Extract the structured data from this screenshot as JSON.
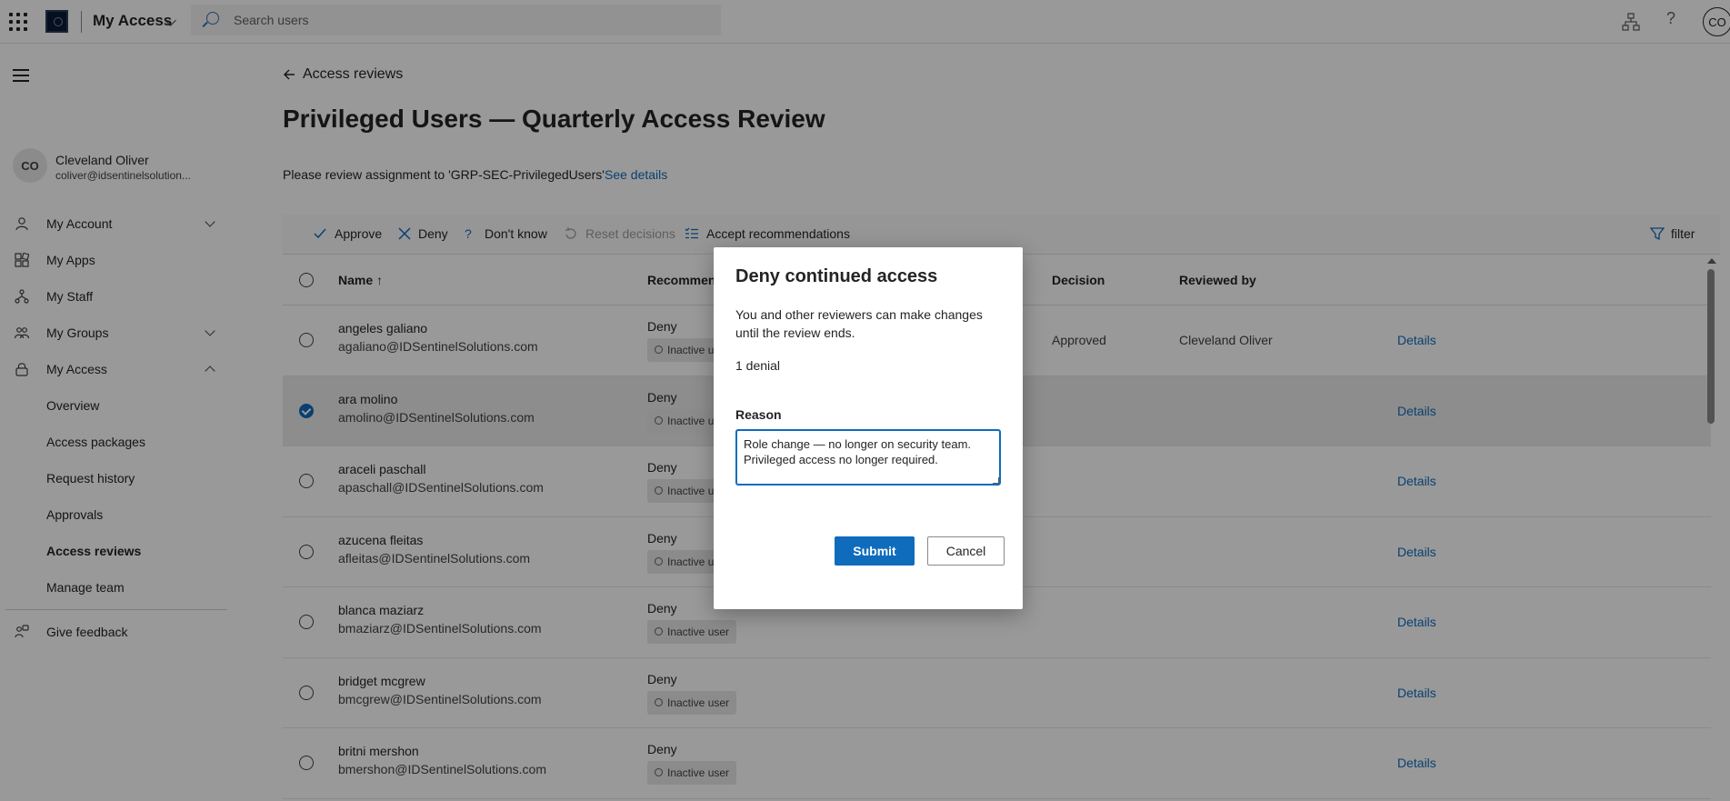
{
  "topbar": {
    "app_title": "My Access",
    "search_placeholder": "Search users",
    "avatar_initials": "CO"
  },
  "user": {
    "initials": "CO",
    "name": "Cleveland Oliver",
    "email": "coliver@idsentinelsolution..."
  },
  "sidebar": {
    "items": [
      {
        "label": "My Account",
        "icon": "person-icon",
        "expandable": true
      },
      {
        "label": "My Apps",
        "icon": "apps-icon",
        "expandable": false
      },
      {
        "label": "My Staff",
        "icon": "staff-icon",
        "expandable": false
      },
      {
        "label": "My Groups",
        "icon": "groups-icon",
        "expandable": true
      },
      {
        "label": "My Access",
        "icon": "lock-icon",
        "expandable": true,
        "expanded": true
      }
    ],
    "sub_items": [
      "Overview",
      "Access packages",
      "Request history",
      "Approvals",
      "Access reviews",
      "Manage team"
    ],
    "active_sub": "Access reviews",
    "feedback": "Give feedback"
  },
  "main": {
    "back_label": "Access reviews",
    "title": "Privileged Users — Quarterly Access Review",
    "instruction": "Please review assignment to 'GRP-SEC-PrivilegedUsers'",
    "see_details": "See details"
  },
  "toolbar": {
    "approve": "Approve",
    "deny": "Deny",
    "dont_know": "Don't know",
    "reset": "Reset decisions",
    "accept": "Accept recommendations",
    "filter": "filter"
  },
  "table": {
    "headers": {
      "name": "Name",
      "recommendation": "Recommen",
      "decision": "Decision",
      "reviewed_by": "Reviewed by"
    },
    "rows": [
      {
        "name": "angeles galiano",
        "email": "agaliano@IDSentinelSolutions.com",
        "rec": "Deny",
        "badge": "Inactive u",
        "decision": "Approved",
        "reviewed_by": "Cleveland Oliver",
        "details": "Details",
        "selected": false
      },
      {
        "name": "ara molino",
        "email": "amolino@IDSentinelSolutions.com",
        "rec": "Deny",
        "badge": "Inactive u",
        "decision": "",
        "reviewed_by": "",
        "details": "Details",
        "selected": true
      },
      {
        "name": "araceli paschall",
        "email": "apaschall@IDSentinelSolutions.com",
        "rec": "Deny",
        "badge": "Inactive u",
        "decision": "",
        "reviewed_by": "",
        "details": "Details",
        "selected": false
      },
      {
        "name": "azucena fleitas",
        "email": "afleitas@IDSentinelSolutions.com",
        "rec": "Deny",
        "badge": "Inactive u",
        "decision": "",
        "reviewed_by": "",
        "details": "Details",
        "selected": false
      },
      {
        "name": "blanca maziarz",
        "email": "bmaziarz@IDSentinelSolutions.com",
        "rec": "Deny",
        "badge": "Inactive user",
        "decision": "",
        "reviewed_by": "",
        "details": "Details",
        "selected": false
      },
      {
        "name": "bridget mcgrew",
        "email": "bmcgrew@IDSentinelSolutions.com",
        "rec": "Deny",
        "badge": "Inactive user",
        "decision": "",
        "reviewed_by": "",
        "details": "Details",
        "selected": false
      },
      {
        "name": "britni mershon",
        "email": "bmershon@IDSentinelSolutions.com",
        "rec": "Deny",
        "badge": "Inactive user",
        "decision": "",
        "reviewed_by": "",
        "details": "Details",
        "selected": false
      }
    ]
  },
  "dialog": {
    "title": "Deny continued access",
    "description": "You and other reviewers can make changes until the review ends.",
    "count": "1 denial",
    "reason_label": "Reason",
    "reason_value": "Role change — no longer on security team. Privileged access no longer required.",
    "submit": "Submit",
    "cancel": "Cancel"
  },
  "colors": {
    "accent": "#0f6cbd",
    "overlay": "rgba(0,0,0,0.40)"
  }
}
